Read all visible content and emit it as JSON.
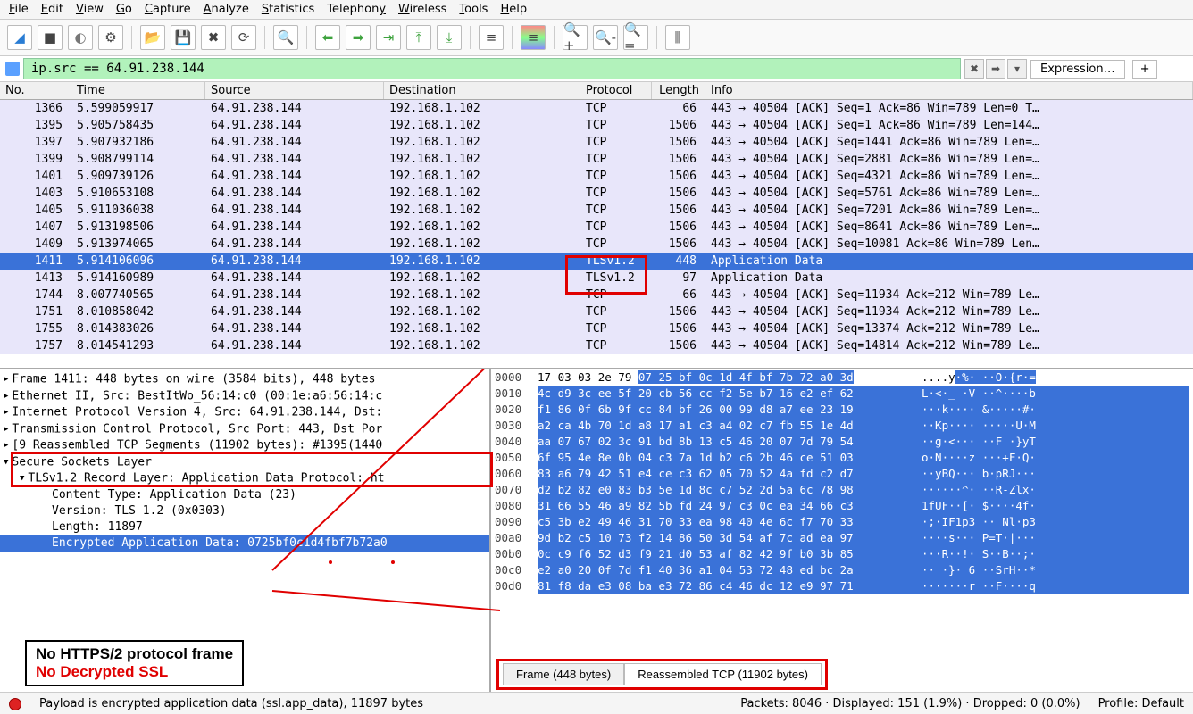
{
  "menu": [
    "File",
    "Edit",
    "View",
    "Go",
    "Capture",
    "Analyze",
    "Statistics",
    "Telephony",
    "Wireless",
    "Tools",
    "Help"
  ],
  "filter": {
    "value": "ip.src == 64.91.238.144",
    "expression_label": "Expression…"
  },
  "columns": {
    "no": "No.",
    "time": "Time",
    "src": "Source",
    "dst": "Destination",
    "proto": "Protocol",
    "len": "Length",
    "info": "Info"
  },
  "selected_index": 8,
  "packets": [
    {
      "no": 1366,
      "time": "5.599059917",
      "src": "64.91.238.144",
      "dst": "192.168.1.102",
      "proto": "TCP",
      "len": 66,
      "info": "443 → 40504 [ACK] Seq=1 Ack=86 Win=789 Len=0 T…"
    },
    {
      "no": 1395,
      "time": "5.905758435",
      "src": "64.91.238.144",
      "dst": "192.168.1.102",
      "proto": "TCP",
      "len": 1506,
      "info": "443 → 40504 [ACK] Seq=1 Ack=86 Win=789 Len=144…"
    },
    {
      "no": 1397,
      "time": "5.907932186",
      "src": "64.91.238.144",
      "dst": "192.168.1.102",
      "proto": "TCP",
      "len": 1506,
      "info": "443 → 40504 [ACK] Seq=1441 Ack=86 Win=789 Len=…"
    },
    {
      "no": 1399,
      "time": "5.908799114",
      "src": "64.91.238.144",
      "dst": "192.168.1.102",
      "proto": "TCP",
      "len": 1506,
      "info": "443 → 40504 [ACK] Seq=2881 Ack=86 Win=789 Len=…"
    },
    {
      "no": 1401,
      "time": "5.909739126",
      "src": "64.91.238.144",
      "dst": "192.168.1.102",
      "proto": "TCP",
      "len": 1506,
      "info": "443 → 40504 [ACK] Seq=4321 Ack=86 Win=789 Len=…"
    },
    {
      "no": 1403,
      "time": "5.910653108",
      "src": "64.91.238.144",
      "dst": "192.168.1.102",
      "proto": "TCP",
      "len": 1506,
      "info": "443 → 40504 [ACK] Seq=5761 Ack=86 Win=789 Len=…"
    },
    {
      "no": 1405,
      "time": "5.911036038",
      "src": "64.91.238.144",
      "dst": "192.168.1.102",
      "proto": "TCP",
      "len": 1506,
      "info": "443 → 40504 [ACK] Seq=7201 Ack=86 Win=789 Len=…"
    },
    {
      "no": 1407,
      "time": "5.913198506",
      "src": "64.91.238.144",
      "dst": "192.168.1.102",
      "proto": "TCP",
      "len": 1506,
      "info": "443 → 40504 [ACK] Seq=8641 Ack=86 Win=789 Len=…"
    },
    {
      "no": 1409,
      "time": "5.913974065",
      "src": "64.91.238.144",
      "dst": "192.168.1.102",
      "proto": "TCP",
      "len": 1506,
      "info": "443 → 40504 [ACK] Seq=10081 Ack=86 Win=789 Len…"
    },
    {
      "no": 1411,
      "time": "5.914106096",
      "src": "64.91.238.144",
      "dst": "192.168.1.102",
      "proto": "TLSv1.2",
      "len": 448,
      "info": "Application Data"
    },
    {
      "no": 1413,
      "time": "5.914160989",
      "src": "64.91.238.144",
      "dst": "192.168.1.102",
      "proto": "TLSv1.2",
      "len": 97,
      "info": "Application Data"
    },
    {
      "no": 1744,
      "time": "8.007740565",
      "src": "64.91.238.144",
      "dst": "192.168.1.102",
      "proto": "TCP",
      "len": 66,
      "info": "443 → 40504 [ACK] Seq=11934 Ack=212 Win=789 Le…"
    },
    {
      "no": 1751,
      "time": "8.010858042",
      "src": "64.91.238.144",
      "dst": "192.168.1.102",
      "proto": "TCP",
      "len": 1506,
      "info": "443 → 40504 [ACK] Seq=11934 Ack=212 Win=789 Le…"
    },
    {
      "no": 1755,
      "time": "8.014383026",
      "src": "64.91.238.144",
      "dst": "192.168.1.102",
      "proto": "TCP",
      "len": 1506,
      "info": "443 → 40504 [ACK] Seq=13374 Ack=212 Win=789 Le…"
    },
    {
      "no": 1757,
      "time": "8.014541293",
      "src": "64.91.238.144",
      "dst": "192.168.1.102",
      "proto": "TCP",
      "len": 1506,
      "info": "443 → 40504 [ACK] Seq=14814 Ack=212 Win=789 Le…"
    }
  ],
  "details": {
    "frame": "Frame 1411: 448 bytes on wire (3584 bits), 448 bytes",
    "eth": "Ethernet II, Src: BestItWo_56:14:c0 (00:1e:a6:56:14:c",
    "ip": "Internet Protocol Version 4, Src: 64.91.238.144, Dst:",
    "tcp": "Transmission Control Protocol, Src Port: 443, Dst Por",
    "reasm": "[9 Reassembled TCP Segments (11902 bytes): #1395(1440",
    "ssl": "Secure Sockets Layer",
    "tls": "TLSv1.2 Record Layer: Application Data Protocol: ht",
    "ctype": "Content Type: Application Data (23)",
    "ver": "Version: TLS 1.2 (0x0303)",
    "length": "Length: 11897",
    "enc": "Encrypted Application Data: 0725bf0c1d4fbf7b72a0"
  },
  "hex": {
    "rows": [
      {
        "off": "0000",
        "b": "17 03 03 2e 79 07 25 bf  0c 1d 4f bf 7b 72 a0 3d",
        "a": "....y·%·  ··O·{r·="
      },
      {
        "off": "0010",
        "b": "4c d9 3c ee 5f 20 cb 56  cc f2 5e b7 16 e2 ef 62",
        "a": "L·<·_ ·V ··^····b"
      },
      {
        "off": "0020",
        "b": "f1 86 0f 6b 9f cc 84 bf  26 00 99 d8 a7 ee 23 19",
        "a": "···k···· &·····#·"
      },
      {
        "off": "0030",
        "b": "a2 ca 4b 70 1d a8 17 a1  c3 a4 02 c7 fb 55 1e 4d",
        "a": "··Kp···· ·····U·M"
      },
      {
        "off": "0040",
        "b": "aa 07 67 02 3c 91 bd 8b  13 c5 46 20 07 7d 79 54",
        "a": "··g·<··· ··F ·}yT"
      },
      {
        "off": "0050",
        "b": "6f 95 4e 8e 0b 04 c3 7a  1d b2 c6 2b 46 ce 51 03",
        "a": "o·N····z ···+F·Q·"
      },
      {
        "off": "0060",
        "b": "83 a6 79 42 51 e4 ce c3  62 05 70 52 4a fd c2 d7",
        "a": "··yBQ··· b·pRJ···"
      },
      {
        "off": "0070",
        "b": "d2 b2 82 e0 83 b3 5e 1d  8c c7 52 2d 5a 6c 78 98",
        "a": "······^· ··R-Zlx·"
      },
      {
        "off": "0080",
        "b": "31 66 55 46 a9 82 5b fd  24 97 c3 0c ea 34 66 c3",
        "a": "1fUF··[· $····4f·"
      },
      {
        "off": "0090",
        "b": "c5 3b e2 49 46 31 70 33  ea 98 40 4e 6c f7 70 33",
        "a": "·;·IF1p3 ·· Nl·p3"
      },
      {
        "off": "00a0",
        "b": "9d b2 c5 10 73 f2 14 86  50 3d 54 af 7c ad ea 97",
        "a": "····s··· P=T·|···"
      },
      {
        "off": "00b0",
        "b": "0c c9 f6 52 d3 f9 21 d0  53 af 82 42 9f b0 3b 85",
        "a": "···R··!· S··B··;·"
      },
      {
        "off": "00c0",
        "b": "e2 a0 20 0f 7d f1 40 36  a1 04 53 72 48 ed bc 2a",
        "a": "·· ·}· 6 ··SrH··*"
      },
      {
        "off": "00d0",
        "b": "81 f8 da e3 08 ba e3 72  86 c4 46 dc 12 e9 97 71",
        "a": "·······r ··F····q"
      }
    ]
  },
  "hex_tabs": {
    "frame": "Frame (448 bytes)",
    "reasm": "Reassembled TCP (11902 bytes)"
  },
  "status": {
    "payload": "Payload is encrypted application data (ssl.app_data), 11897 bytes",
    "packets": "Packets: 8046 · Displayed: 151 (1.9%) · Dropped: 0 (0.0%)",
    "profile": "Profile: Default"
  },
  "annotation": {
    "line1": "No HTTPS/2 protocol frame",
    "line2": "No Decrypted SSL"
  }
}
